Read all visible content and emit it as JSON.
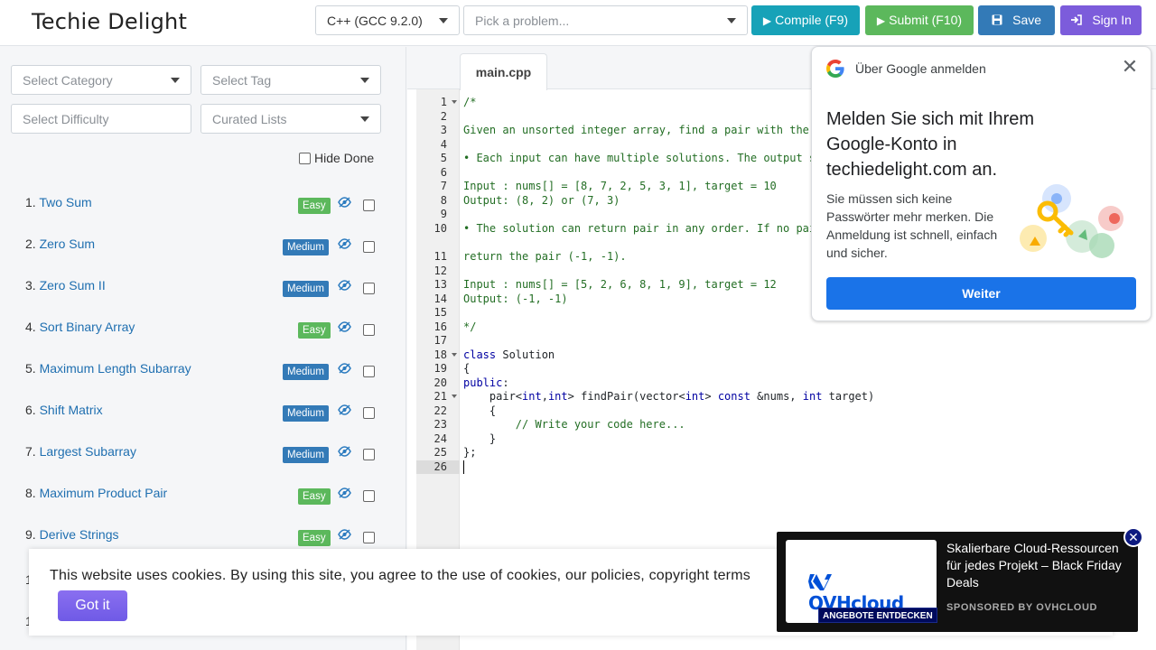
{
  "header": {
    "brand": "Techie Delight",
    "language": "C++ (GCC 9.2.0)",
    "problem_placeholder": "Pick a problem...",
    "compile_label": "Compile (F9)",
    "submit_label": "Submit (F10)",
    "save_label": "Save",
    "signin_label": "Sign In"
  },
  "sidebar": {
    "category_placeholder": "Select Category",
    "tag_placeholder": "Select Tag",
    "difficulty_placeholder": "Select Difficulty",
    "curated_placeholder": "Curated Lists",
    "hide_done_label": "Hide Done",
    "problems": [
      {
        "num": "1.",
        "title": "Two Sum",
        "difficulty": "Easy"
      },
      {
        "num": "2.",
        "title": "Zero Sum",
        "difficulty": "Medium"
      },
      {
        "num": "3.",
        "title": "Zero Sum II",
        "difficulty": "Medium"
      },
      {
        "num": "4.",
        "title": "Sort Binary Array",
        "difficulty": "Easy"
      },
      {
        "num": "5.",
        "title": "Maximum Length Subarray",
        "difficulty": "Medium"
      },
      {
        "num": "6.",
        "title": "Shift Matrix",
        "difficulty": "Medium"
      },
      {
        "num": "7.",
        "title": "Largest Subarray",
        "difficulty": "Medium"
      },
      {
        "num": "8.",
        "title": "Maximum Product Pair",
        "difficulty": "Easy"
      },
      {
        "num": "9.",
        "title": "Derive Strings",
        "difficulty": "Easy"
      }
    ],
    "peek_1": "1",
    "peek_2": "1"
  },
  "editor": {
    "tab": "main.cpp",
    "lines": [
      "/*",
      "",
      "Given an unsorted integer array, find a pair with the g",
      "",
      "• Each input can have multiple solutions. The output sh",
      "",
      "Input : nums[] = [8, 7, 2, 5, 3, 1], target = 10",
      "Output: (8, 2) or (7, 3)",
      "",
      "• The solution can return pair in any order. If no pair",
      "return the pair (-1, -1).",
      "",
      "Input : nums[] = [5, 2, 6, 8, 1, 9], target = 12",
      "Output: (-1, -1)",
      "",
      "*/",
      "",
      "class Solution",
      "{",
      "public:",
      "    pair<int,int> findPair(vector<int> const &nums, int target)",
      "    {",
      "        // Write your code here...",
      "    }",
      "};",
      ""
    ]
  },
  "google_popup": {
    "header": "Über Google anmelden",
    "title": "Melden Sie sich mit Ihrem Google-Konto in techiedelight.com an.",
    "body": "Sie müssen sich keine Passwörter mehr merken. Die Anmeldung ist schnell, einfach und sicher.",
    "button": "Weiter"
  },
  "cookie": {
    "text": "This website uses cookies. By using this site, you agree to the use of cookies, our policies, copyright terms",
    "button": "Got it"
  },
  "ad": {
    "logo": "OVHcloud",
    "cta": "ANGEBOTE ENTDECKEN",
    "headline": "Skalierbare Cloud-Ressourcen für jedes Projekt – Black Friday Deals",
    "sponsor": "SPONSORED BY OVHCLOUD"
  },
  "colors": {
    "compile": "#17a2b8",
    "submit": "#5cb85c",
    "save": "#337ab7",
    "signin": "#7c5cdb",
    "easy": "#5cb85c",
    "medium": "#337ab7",
    "google_blue": "#1a73e8"
  }
}
